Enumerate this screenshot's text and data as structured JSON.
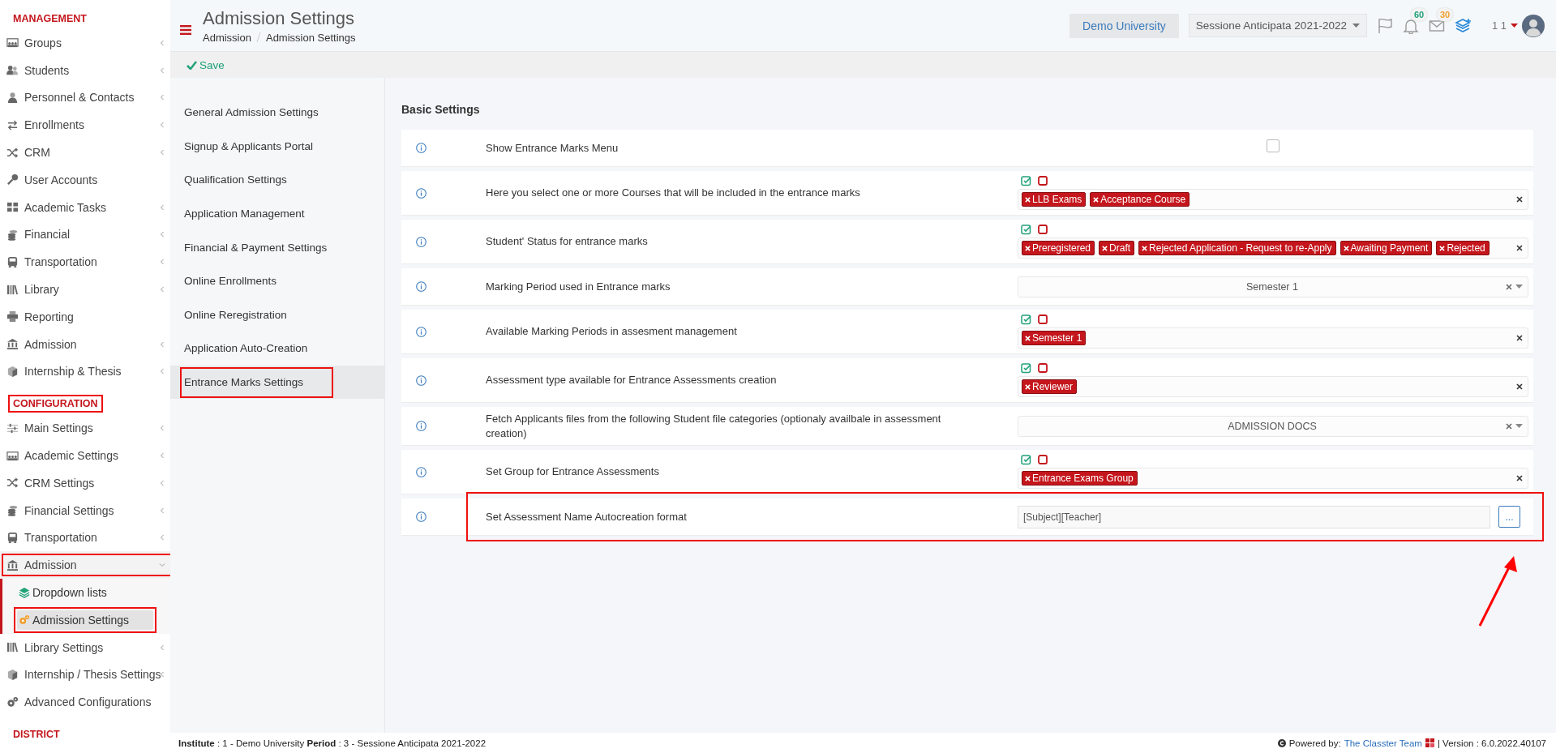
{
  "sidebar": {
    "sections": [
      {
        "title": "MANAGEMENT",
        "highlighted": false,
        "items": [
          {
            "label": "Groups",
            "expandable": true,
            "expanded": false,
            "selected": false,
            "highlighted": false
          },
          {
            "label": "Students",
            "expandable": true,
            "expanded": false,
            "selected": false,
            "highlighted": false
          },
          {
            "label": "Personnel & Contacts",
            "expandable": true,
            "expanded": false,
            "selected": false,
            "highlighted": false
          },
          {
            "label": "Enrollments",
            "expandable": true,
            "expanded": false,
            "selected": false,
            "highlighted": false
          },
          {
            "label": "CRM",
            "expandable": true,
            "expanded": false,
            "selected": false,
            "highlighted": false
          },
          {
            "label": "User Accounts",
            "expandable": false,
            "expanded": false,
            "selected": false,
            "highlighted": false
          },
          {
            "label": "Academic Tasks",
            "expandable": true,
            "expanded": false,
            "selected": false,
            "highlighted": false
          },
          {
            "label": "Financial",
            "expandable": true,
            "expanded": false,
            "selected": false,
            "highlighted": false
          },
          {
            "label": "Transportation",
            "expandable": true,
            "expanded": false,
            "selected": false,
            "highlighted": false
          },
          {
            "label": "Library",
            "expandable": true,
            "expanded": false,
            "selected": false,
            "highlighted": false
          },
          {
            "label": "Reporting",
            "expandable": false,
            "expanded": false,
            "selected": false,
            "highlighted": false
          },
          {
            "label": "Admission",
            "expandable": true,
            "expanded": false,
            "selected": false,
            "highlighted": false
          },
          {
            "label": "Internship & Thesis",
            "expandable": true,
            "expanded": false,
            "selected": false,
            "highlighted": false
          }
        ]
      },
      {
        "title": "CONFIGURATION",
        "highlighted": true,
        "items": [
          {
            "label": "Main Settings",
            "expandable": true,
            "expanded": false,
            "selected": false,
            "highlighted": false
          },
          {
            "label": "Academic Settings",
            "expandable": true,
            "expanded": false,
            "selected": false,
            "highlighted": false
          },
          {
            "label": "CRM Settings",
            "expandable": true,
            "expanded": false,
            "selected": false,
            "highlighted": false
          },
          {
            "label": "Financial Settings",
            "expandable": true,
            "expanded": false,
            "selected": false,
            "highlighted": false
          },
          {
            "label": "Transportation",
            "expandable": true,
            "expanded": false,
            "selected": false,
            "highlighted": false
          },
          {
            "label": "Admission",
            "expandable": true,
            "expanded": true,
            "selected": false,
            "highlighted": true,
            "children": [
              {
                "label": "Dropdown lists",
                "selected": false,
                "highlighted": false
              },
              {
                "label": "Admission Settings",
                "selected": true,
                "highlighted": true
              }
            ]
          },
          {
            "label": "Library Settings",
            "expandable": true,
            "expanded": false,
            "selected": false,
            "highlighted": false
          },
          {
            "label": "Internship / Thesis Settings",
            "expandable": true,
            "expanded": false,
            "selected": false,
            "highlighted": false
          },
          {
            "label": "Advanced Configurations",
            "expandable": false,
            "expanded": false,
            "selected": false,
            "highlighted": false
          }
        ]
      },
      {
        "title": "DISTRICT",
        "highlighted": false
      }
    ]
  },
  "header": {
    "title": "Admission Settings",
    "breadcrumbs": [
      "Admission",
      "Admission Settings"
    ],
    "institute": "Demo University",
    "period": "Sessione Anticipata 2021-2022",
    "notifications": "60",
    "messages": "30",
    "user": "1 1"
  },
  "toolbar": {
    "save": "Save"
  },
  "settings_menu": [
    {
      "label": "General Admission Settings",
      "selected": false,
      "highlighted": false
    },
    {
      "label": "Signup & Applicants Portal",
      "selected": false,
      "highlighted": false
    },
    {
      "label": "Qualification Settings",
      "selected": false,
      "highlighted": false
    },
    {
      "label": "Application Management",
      "selected": false,
      "highlighted": false
    },
    {
      "label": "Financial & Payment Settings",
      "selected": false,
      "highlighted": false
    },
    {
      "label": "Online Enrollments",
      "selected": false,
      "highlighted": false
    },
    {
      "label": "Online Reregistration",
      "selected": false,
      "highlighted": false
    },
    {
      "label": "Application Auto-Creation",
      "selected": false,
      "highlighted": false
    },
    {
      "label": "Entrance Marks Settings",
      "selected": true,
      "highlighted": true
    }
  ],
  "settings": {
    "title": "Basic Settings",
    "rows": [
      {
        "kind": "checkbox",
        "label": "Show Entrance Marks Menu",
        "checked": false,
        "highlighted": false
      },
      {
        "kind": "multiselect",
        "label": "Here you select one or more Courses that will be included in the entrance marks",
        "tags": [
          "LLB Exams",
          "Acceptance Course"
        ],
        "highlighted": false
      },
      {
        "kind": "multiselect",
        "label": "Student' Status for entrance marks",
        "tags": [
          "Preregistered",
          "Draft",
          "Rejected Application - Request to re-Apply",
          "Awaiting Payment",
          "Rejected"
        ],
        "highlighted": false
      },
      {
        "kind": "select",
        "label": "Marking Period used in Entrance marks",
        "value": "Semester 1",
        "highlighted": false
      },
      {
        "kind": "multiselect",
        "label": "Available Marking Periods in assesment management",
        "tags": [
          "Semester 1"
        ],
        "highlighted": false
      },
      {
        "kind": "multiselect",
        "label": "Assessment type available for Entrance Assessments creation",
        "tags": [
          "Reviewer"
        ],
        "highlighted": false
      },
      {
        "kind": "select",
        "label": "Fetch Applicants files from the following Student file categories (optionaly availbale in assessment creation)",
        "value": "ADMISSION DOCS",
        "highlighted": false
      },
      {
        "kind": "multiselect",
        "label": "Set Group for Entrance Assessments",
        "tags": [
          "Entrance Exams Group"
        ],
        "highlighted": false
      },
      {
        "kind": "text-button",
        "label": "Set Assessment Name Autocreation format",
        "value": "[Subject][Teacher]",
        "button": "...",
        "highlighted": true
      }
    ]
  },
  "footer": {
    "info": "**Institute** : 1 - Demo University **Period** : 3 - Sessione Anticipata 2021-2022",
    "powered_by": "Powered by:",
    "team": "The Classter Team",
    "version": "| Version : 6.0.2022.40107"
  }
}
